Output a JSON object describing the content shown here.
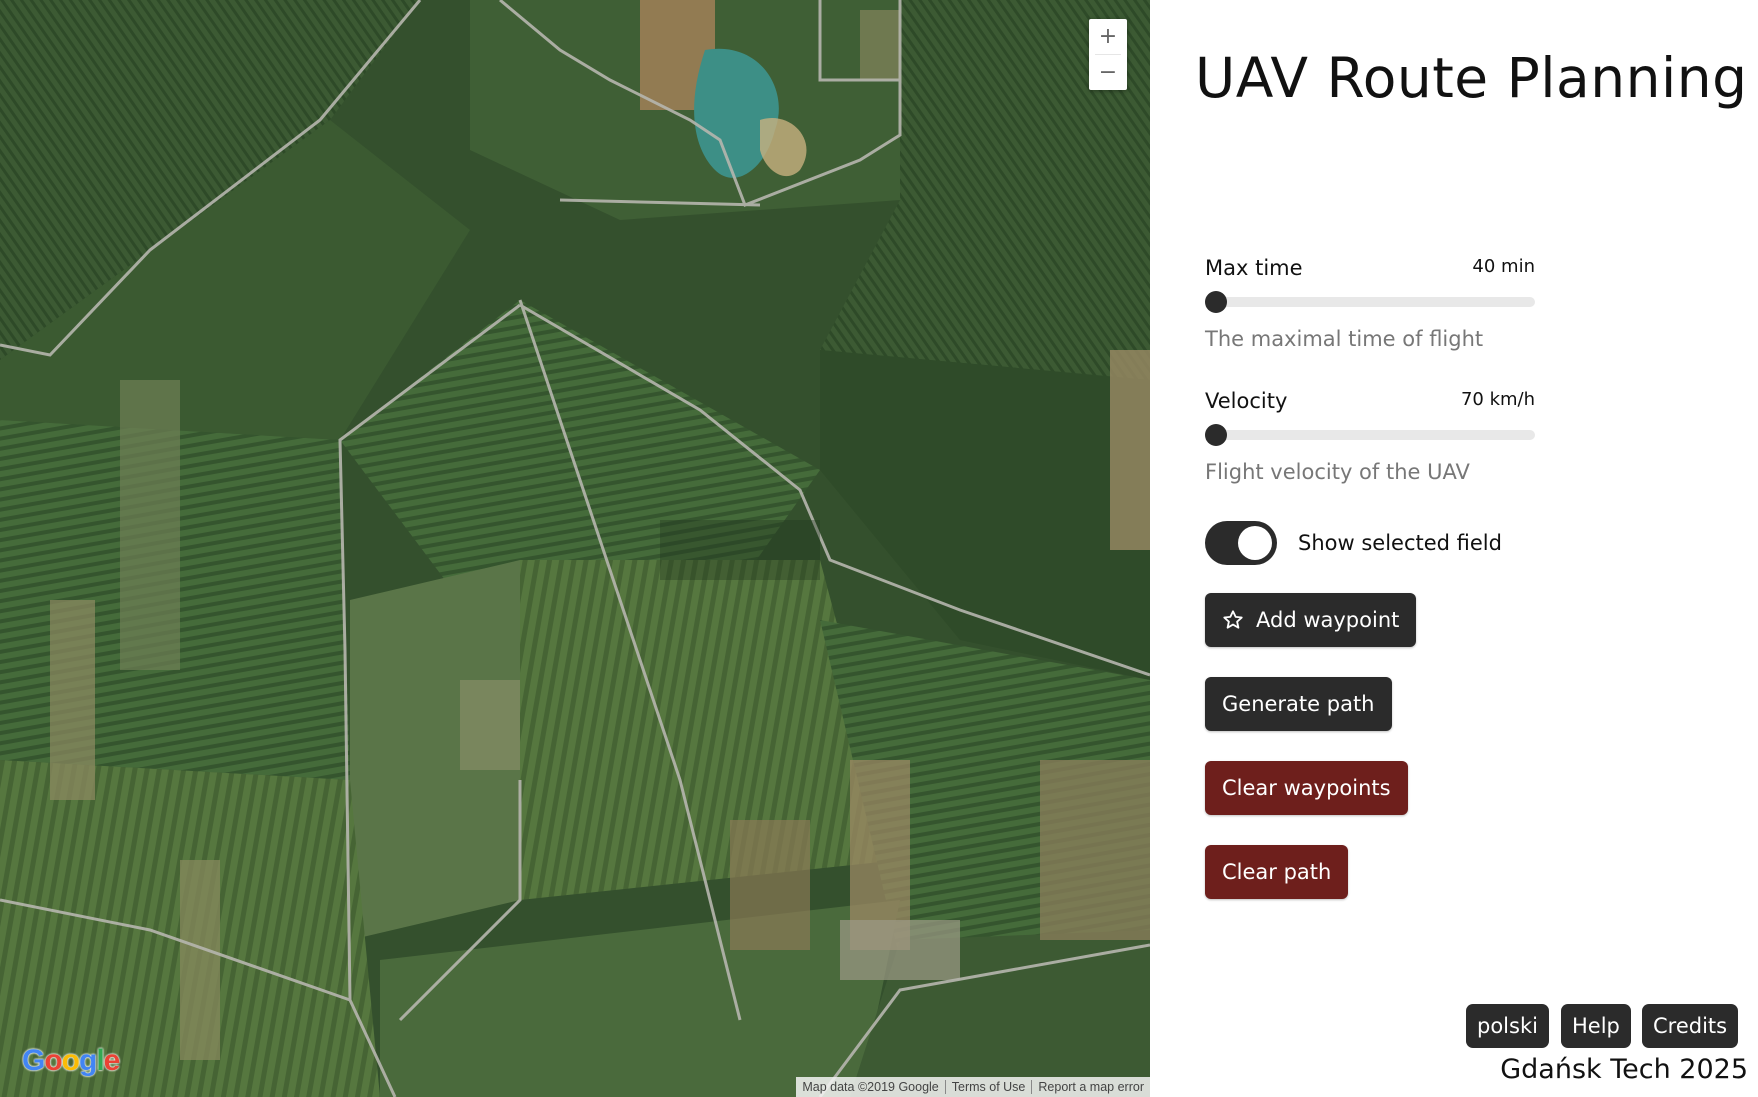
{
  "map": {
    "zoom_in_label": "+",
    "zoom_out_label": "−",
    "logo_letters": [
      "G",
      "o",
      "o",
      "g",
      "l",
      "e"
    ],
    "attribution": {
      "map_data": "Map data ©2019 Google",
      "terms": "Terms of Use",
      "report": "Report a map error"
    }
  },
  "panel": {
    "title": "UAV Route Planning",
    "max_time": {
      "label": "Max time",
      "value": "40 min",
      "help": "The maximal time of flight",
      "level": 0
    },
    "velocity": {
      "label": "Velocity",
      "value": "70 km/h",
      "help": "Flight velocity of the UAV",
      "level": 0
    },
    "show_field": {
      "label": "Show selected field",
      "checked": true
    },
    "buttons": {
      "add_waypoint": "Add waypoint",
      "generate_path": "Generate path",
      "clear_waypoints": "Clear waypoints",
      "clear_path": "Clear path"
    },
    "footer": {
      "lang": "polski",
      "help": "Help",
      "credits": "Credits",
      "org": "Gdańsk Tech 2025"
    }
  },
  "colors": {
    "dark_button": "#2b2b2b",
    "danger_button": "#6e1f1c",
    "slider_track": "#e8e8e8",
    "help_text": "#777777"
  },
  "icons": [
    "star-icon",
    "plus-icon",
    "minus-icon"
  ]
}
